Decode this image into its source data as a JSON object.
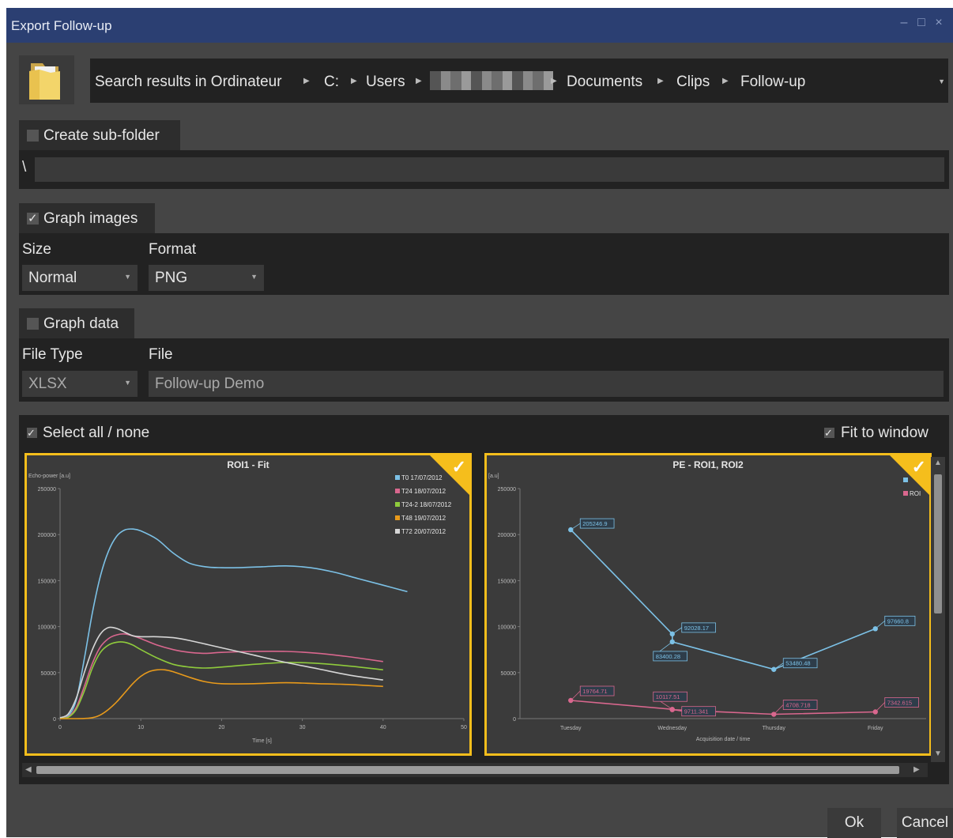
{
  "window": {
    "title": "Export Follow-up"
  },
  "address": {
    "crumbs": [
      "Search results in Ordinateur",
      "C:",
      "Users",
      "",
      "Documents",
      "Clips",
      "Follow-up"
    ]
  },
  "subfolder": {
    "label": "Create sub-folder",
    "checked": false,
    "prefix": "\\",
    "value": ""
  },
  "graph_images": {
    "label": "Graph images",
    "checked": true,
    "size_label": "Size",
    "size_value": "Normal",
    "format_label": "Format",
    "format_value": "PNG"
  },
  "graph_data": {
    "label": "Graph data",
    "checked": false,
    "filetype_label": "File Type",
    "filetype_value": "XLSX",
    "file_label": "File",
    "file_value": "Follow-up Demo"
  },
  "selection": {
    "select_all_label": "Select all / none",
    "select_all_checked": true,
    "fit_label": "Fit to window",
    "fit_checked": true
  },
  "buttons": {
    "ok": "Ok",
    "cancel": "Cancel"
  },
  "colors": {
    "accent": "#f5be1c",
    "titlebar": "#2b3f72",
    "blue": "#7cc1e6",
    "pink": "#d9678e",
    "green": "#8fcb3c",
    "orange": "#e89a1b",
    "white": "#d6d6d6"
  },
  "chart_data": [
    {
      "type": "line",
      "title": "ROI1 - Fit",
      "xlabel": "Time [s]",
      "ylabel": "Echo-power [a.u]",
      "xlim": [
        0,
        50
      ],
      "ylim": [
        0,
        250000
      ],
      "xticks": [
        "0",
        "10",
        "20",
        "30",
        "40",
        "50"
      ],
      "yticks": [
        "0",
        "50000",
        "100000",
        "150000",
        "200000",
        "250000"
      ],
      "legend": "top-right",
      "series": [
        {
          "name": "T0 17/07/2012",
          "color": "#7cc1e6",
          "x": [
            0,
            1,
            2,
            3,
            4,
            5,
            6,
            7,
            8,
            9,
            10,
            12,
            14,
            16,
            18,
            20,
            22,
            25,
            28,
            31,
            34,
            37,
            40,
            43
          ],
          "y": [
            1000,
            3000,
            20000,
            65000,
            115000,
            155000,
            182000,
            198000,
            205000,
            206000,
            204000,
            195000,
            180000,
            169000,
            165000,
            164000,
            164000,
            165000,
            166000,
            164000,
            159000,
            152000,
            145000,
            138000
          ]
        },
        {
          "name": "T24 18/07/2012",
          "color": "#d9678e",
          "x": [
            0,
            1,
            2,
            3,
            4,
            5,
            6,
            7,
            8,
            9,
            10,
            12,
            14,
            16,
            18,
            20,
            24,
            28,
            32,
            36,
            40
          ],
          "y": [
            1000,
            2000,
            12000,
            35000,
            60000,
            78000,
            87000,
            91000,
            92000,
            90000,
            87000,
            80000,
            75000,
            72000,
            71000,
            72000,
            73000,
            73000,
            71000,
            67000,
            62000
          ]
        },
        {
          "name": "T24-2 18/07/2012",
          "color": "#8fcb3c",
          "x": [
            0,
            1,
            2,
            3,
            4,
            5,
            6,
            7,
            8,
            9,
            10,
            12,
            14,
            16,
            18,
            20,
            24,
            28,
            32,
            36,
            40
          ],
          "y": [
            500,
            1500,
            10000,
            30000,
            55000,
            72000,
            80000,
            83000,
            83000,
            80000,
            75000,
            66000,
            59000,
            56000,
            55000,
            56000,
            59000,
            61000,
            60000,
            57000,
            53000
          ]
        },
        {
          "name": "T48 19/07/2012",
          "color": "#e89a1b",
          "x": [
            0,
            2,
            3,
            4,
            5,
            6,
            7,
            8,
            9,
            10,
            11,
            12,
            13,
            14,
            16,
            18,
            20,
            24,
            28,
            32,
            36,
            40
          ],
          "y": [
            0,
            0,
            200,
            1000,
            4000,
            10000,
            18000,
            28000,
            38000,
            46000,
            51000,
            53000,
            53000,
            51000,
            45000,
            40000,
            38000,
            38000,
            39000,
            38000,
            37000,
            35000
          ]
        },
        {
          "name": "T72 20/07/2012",
          "color": "#d6d6d6",
          "x": [
            0,
            1,
            2,
            3,
            4,
            5,
            6,
            7,
            8,
            9,
            10,
            12,
            14,
            16,
            18,
            20,
            24,
            28,
            32,
            36,
            40
          ],
          "y": [
            1000,
            5000,
            22000,
            50000,
            75000,
            92000,
            99000,
            98000,
            94000,
            90000,
            89000,
            89000,
            88000,
            85000,
            81000,
            77000,
            69000,
            61000,
            54000,
            47000,
            42000
          ]
        }
      ]
    },
    {
      "type": "line",
      "title": "PE - ROI1, ROI2",
      "xlabel": "Acquisition date / time",
      "ylabel": "[a.u]",
      "ylim": [
        0,
        250000
      ],
      "yticks": [
        "0",
        "50000",
        "100000",
        "150000",
        "200000",
        "250000"
      ],
      "categories": [
        "Tuesday",
        "Wednesday",
        "Thursday",
        "Friday"
      ],
      "legend": "top-right",
      "series": [
        {
          "name": "",
          "color": "#7cc1e6",
          "points": [
            {
              "x": 0,
              "y": 205246.9,
              "label": "205246.9"
            },
            {
              "x": 1,
              "y": 92028.17,
              "label": "92028.17"
            },
            {
              "x": 1,
              "y": 83400.28,
              "label": "83400.28"
            },
            {
              "x": 2,
              "y": 53480.48,
              "label": "53480.48"
            },
            {
              "x": 3,
              "y": 97660.8,
              "label": "97660.8"
            }
          ]
        },
        {
          "name": "ROI",
          "color": "#d9678e",
          "points": [
            {
              "x": 0,
              "y": 19764.71,
              "label": "19764.71"
            },
            {
              "x": 1,
              "y": 10117.51,
              "label": "10117.51"
            },
            {
              "x": 1,
              "y": 9711.341,
              "label": "9711.341"
            },
            {
              "x": 2,
              "y": 4708.718,
              "label": "4708.718"
            },
            {
              "x": 3,
              "y": 7342.615,
              "label": "7342.615"
            }
          ]
        }
      ]
    }
  ]
}
